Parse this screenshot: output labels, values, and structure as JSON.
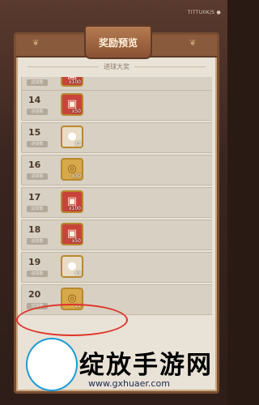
{
  "status_text": "TITTU0K/S ●",
  "panel": {
    "title": "奖励预览",
    "subtitle": "进球大奖"
  },
  "rows": [
    {
      "rank": "",
      "tag": "进球数",
      "item": "red",
      "qty": "x100"
    },
    {
      "rank": "14",
      "tag": "进球数",
      "item": "red",
      "qty": "x50"
    },
    {
      "rank": "15",
      "tag": "进球数",
      "item": "white",
      "qty": "x5"
    },
    {
      "rank": "16",
      "tag": "进球数",
      "item": "gold",
      "qty": "x30"
    },
    {
      "rank": "17",
      "tag": "进球数",
      "item": "red",
      "qty": "x100"
    },
    {
      "rank": "18",
      "tag": "进球数",
      "item": "red",
      "qty": "x50"
    },
    {
      "rank": "19",
      "tag": "进球数",
      "item": "white",
      "qty": "x5"
    },
    {
      "rank": "20",
      "tag": "进球数",
      "item": "gold",
      "qty": "x1"
    }
  ],
  "watermark": {
    "title": "绽放手游网",
    "url": "www.gxhuaer.com"
  }
}
